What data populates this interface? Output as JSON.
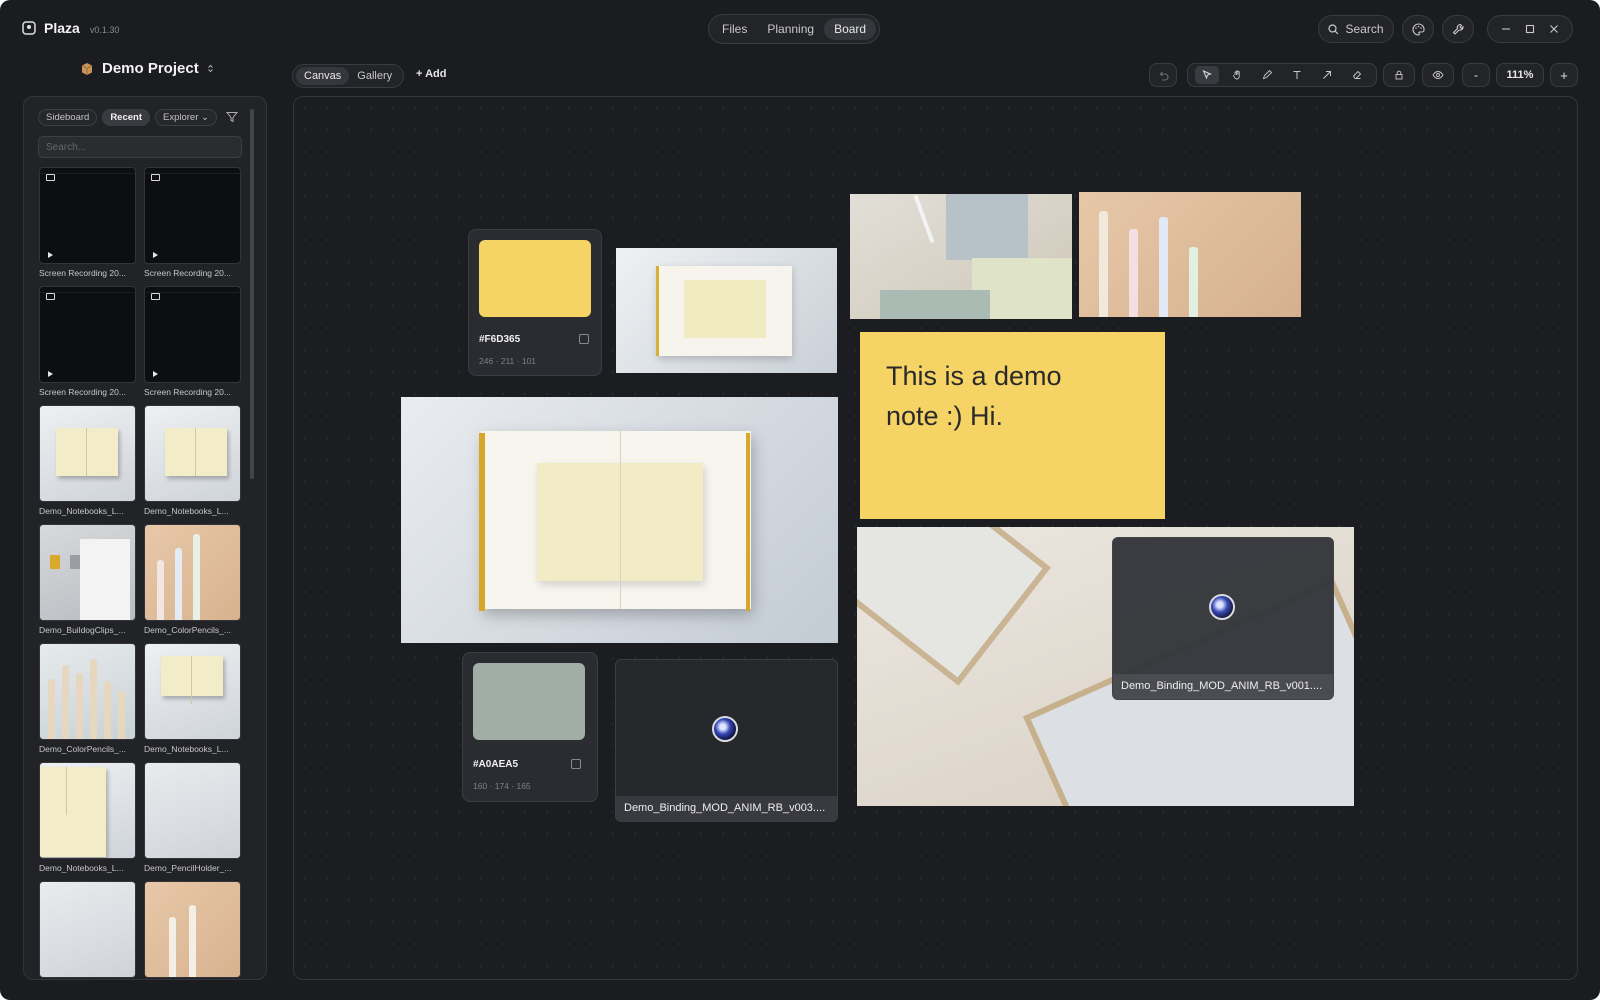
{
  "app": {
    "name": "Plaza",
    "version": "v0.1.30"
  },
  "topnav": {
    "tabs": [
      {
        "label": "Files"
      },
      {
        "label": "Planning"
      },
      {
        "label": "Board"
      }
    ],
    "active": "Board"
  },
  "header": {
    "search_label": "Search"
  },
  "project": {
    "name": "Demo Project"
  },
  "view": {
    "tabs": [
      {
        "label": "Canvas"
      },
      {
        "label": "Gallery"
      }
    ],
    "active": "Canvas",
    "add_label": "+ Add"
  },
  "toolbar": {
    "zoom": "111%",
    "minus": "-",
    "plus": "+"
  },
  "sidebar": {
    "tabs": [
      {
        "label": "Sideboard"
      },
      {
        "label": "Recent"
      },
      {
        "label": "Explorer"
      }
    ],
    "active": "Recent",
    "search_placeholder": "Search...",
    "items": [
      {
        "label": "Screen Recording 20...",
        "kind": "recording"
      },
      {
        "label": "Screen Recording 20...",
        "kind": "recording"
      },
      {
        "label": "Screen Recording 20...",
        "kind": "recording"
      },
      {
        "label": "Screen Recording 20...",
        "kind": "recording"
      },
      {
        "label": "Demo_Notebooks_L...",
        "kind": "notebook"
      },
      {
        "label": "Demo_Notebooks_L...",
        "kind": "notebook"
      },
      {
        "label": "Demo_BuildogClips_...",
        "kind": "clips"
      },
      {
        "label": "Demo_ColorPencils_...",
        "kind": "pencils"
      },
      {
        "label": "Demo_ColorPencils_...",
        "kind": "pencils"
      },
      {
        "label": "Demo_Notebooks_L...",
        "kind": "notebook"
      },
      {
        "label": "Demo_Notebooks_L...",
        "kind": "notebook"
      },
      {
        "label": "Demo_PencilHolder_...",
        "kind": "holder"
      },
      {
        "label": "",
        "kind": "holder"
      },
      {
        "label": "",
        "kind": "pencils"
      }
    ]
  },
  "board": {
    "swatch1": {
      "hex": "#F6D365",
      "rgb": "246 · 211 · 101",
      "color": "#F6D365"
    },
    "swatch2": {
      "hex": "#A0AEA5",
      "rgb": "160 · 174 · 165",
      "color": "#A0AEA5"
    },
    "note": {
      "line1": "This is a demo",
      "line2": "note :) Hi."
    },
    "video1": {
      "label": "Demo_Binding_MOD_ANIM_RB_v003...."
    },
    "video2": {
      "label": "Demo_Binding_MOD_ANIM_RB_v001...."
    }
  }
}
